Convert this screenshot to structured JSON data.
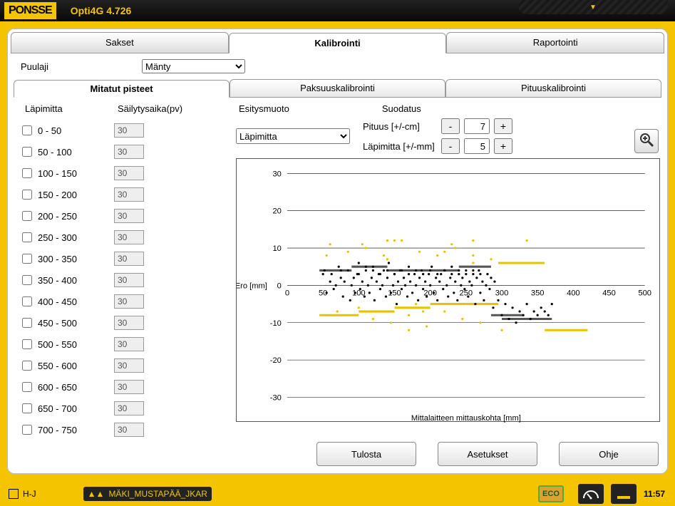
{
  "app": {
    "brand": "PONSSE",
    "title": "Opti4G 4.726"
  },
  "main_tabs": [
    {
      "label": "Sakset",
      "active": false
    },
    {
      "label": "Kalibrointi",
      "active": true
    },
    {
      "label": "Raportointi",
      "active": false
    }
  ],
  "species": {
    "label": "Puulaji",
    "selected": "Mänty",
    "options": [
      "Mänty"
    ]
  },
  "sub_tabs": [
    {
      "label": "Mitatut pisteet",
      "active": true
    },
    {
      "label": "Paksuuskalibrointi",
      "active": false
    },
    {
      "label": "Pituuskalibrointi",
      "active": false
    }
  ],
  "left": {
    "headers": {
      "diameter": "Läpimitta",
      "retention": "Säilytysaika(pv)"
    },
    "rows": [
      {
        "range": "0   - 50",
        "days": "30"
      },
      {
        "range": "50  - 100",
        "days": "30"
      },
      {
        "range": "100 - 150",
        "days": "30"
      },
      {
        "range": "150 - 200",
        "days": "30"
      },
      {
        "range": "200 - 250",
        "days": "30"
      },
      {
        "range": "250 - 300",
        "days": "30"
      },
      {
        "range": "300 - 350",
        "days": "30"
      },
      {
        "range": "350 - 400",
        "days": "30"
      },
      {
        "range": "400 - 450",
        "days": "30"
      },
      {
        "range": "450 - 500",
        "days": "30"
      },
      {
        "range": "500 - 550",
        "days": "30"
      },
      {
        "range": "550 - 600",
        "days": "30"
      },
      {
        "range": "600 - 650",
        "days": "30"
      },
      {
        "range": "650 - 700",
        "days": "30"
      },
      {
        "range": "700 - 750",
        "days": "30"
      }
    ]
  },
  "right": {
    "presentation_label": "Esitysmuoto",
    "presentation_value": "Läpimitta",
    "presentation_options": [
      "Läpimitta"
    ],
    "filter_label": "Suodatus",
    "length_label": "Pituus [+/-cm]",
    "length_value": "7",
    "diameter_label": "Läpimitta [+/-mm]",
    "diameter_value": "5",
    "minus": "-",
    "plus": "+",
    "zoom_icon": "⊕"
  },
  "chart_data": {
    "type": "scatter",
    "title": "",
    "xlabel": "Mittalaitteen mittauskohta [mm]",
    "ylabel": "Ero [mm]",
    "xlim": [
      0,
      500
    ],
    "ylim": [
      -30,
      30
    ],
    "xticks": [
      0,
      50,
      100,
      150,
      200,
      250,
      300,
      350,
      400,
      450,
      500
    ],
    "yticks": [
      -30,
      -20,
      -10,
      0,
      10,
      20,
      30
    ],
    "series": [
      {
        "name": "black",
        "color": "#000000",
        "points": [
          [
            52,
            4
          ],
          [
            55,
            -2
          ],
          [
            60,
            1
          ],
          [
            62,
            3
          ],
          [
            65,
            -1
          ],
          [
            68,
            0
          ],
          [
            72,
            5
          ],
          [
            75,
            2
          ],
          [
            78,
            -3
          ],
          [
            80,
            1
          ],
          [
            85,
            4
          ],
          [
            88,
            -4
          ],
          [
            90,
            0
          ],
          [
            93,
            2
          ],
          [
            95,
            -2
          ],
          [
            98,
            3
          ],
          [
            100,
            6
          ],
          [
            102,
            -1
          ],
          [
            105,
            1
          ],
          [
            108,
            -3
          ],
          [
            110,
            4
          ],
          [
            113,
            0
          ],
          [
            115,
            -2
          ],
          [
            118,
            2
          ],
          [
            120,
            5
          ],
          [
            122,
            -4
          ],
          [
            125,
            1
          ],
          [
            128,
            3
          ],
          [
            130,
            -1
          ],
          [
            133,
            0
          ],
          [
            135,
            4
          ],
          [
            138,
            -3
          ],
          [
            140,
            2
          ],
          [
            142,
            6
          ],
          [
            145,
            -2
          ],
          [
            148,
            0
          ],
          [
            150,
            3
          ],
          [
            153,
            -5
          ],
          [
            155,
            1
          ],
          [
            158,
            4
          ],
          [
            160,
            -1
          ],
          [
            163,
            2
          ],
          [
            165,
            0
          ],
          [
            168,
            -3
          ],
          [
            170,
            5
          ],
          [
            172,
            1
          ],
          [
            175,
            -2
          ],
          [
            178,
            3
          ],
          [
            180,
            0
          ],
          [
            183,
            -4
          ],
          [
            185,
            2
          ],
          [
            188,
            4
          ],
          [
            190,
            -1
          ],
          [
            193,
            1
          ],
          [
            195,
            -3
          ],
          [
            198,
            3
          ],
          [
            200,
            0
          ],
          [
            202,
            5
          ],
          [
            205,
            -2
          ],
          [
            208,
            2
          ],
          [
            210,
            -4
          ],
          [
            213,
            1
          ],
          [
            215,
            3
          ],
          [
            218,
            -1
          ],
          [
            220,
            4
          ],
          [
            223,
            0
          ],
          [
            225,
            -3
          ],
          [
            228,
            2
          ],
          [
            230,
            5
          ],
          [
            233,
            -2
          ],
          [
            235,
            1
          ],
          [
            238,
            -4
          ],
          [
            240,
            3
          ],
          [
            243,
            0
          ],
          [
            245,
            2
          ],
          [
            248,
            -1
          ],
          [
            250,
            4
          ],
          [
            253,
            -3
          ],
          [
            255,
            1
          ],
          [
            258,
            0
          ],
          [
            260,
            3
          ],
          [
            263,
            -5
          ],
          [
            265,
            2
          ],
          [
            268,
            4
          ],
          [
            270,
            -2
          ],
          [
            273,
            1
          ],
          [
            275,
            -4
          ],
          [
            278,
            0
          ],
          [
            280,
            3
          ],
          [
            283,
            -1
          ],
          [
            285,
            2
          ],
          [
            288,
            -6
          ],
          [
            290,
            1
          ],
          [
            295,
            -4
          ],
          [
            300,
            -8
          ],
          [
            305,
            -5
          ],
          [
            310,
            -9
          ],
          [
            315,
            -6
          ],
          [
            320,
            -10
          ],
          [
            325,
            -7
          ],
          [
            330,
            -8
          ],
          [
            335,
            -5
          ],
          [
            340,
            -9
          ],
          [
            345,
            -7
          ],
          [
            350,
            -8
          ],
          [
            355,
            -6
          ],
          [
            360,
            -7
          ],
          [
            365,
            -8
          ],
          [
            370,
            -5
          ],
          [
            50,
            3
          ],
          [
            75,
            4
          ],
          [
            100,
            3
          ],
          [
            110,
            5
          ],
          [
            120,
            4
          ],
          [
            130,
            3
          ],
          [
            140,
            4
          ],
          [
            150,
            3
          ],
          [
            160,
            4
          ],
          [
            170,
            3
          ],
          [
            180,
            4
          ],
          [
            190,
            3
          ],
          [
            200,
            4
          ],
          [
            210,
            3
          ],
          [
            220,
            4
          ],
          [
            230,
            3
          ],
          [
            240,
            4
          ],
          [
            250,
            3
          ],
          [
            260,
            4
          ],
          [
            270,
            3
          ]
        ]
      },
      {
        "name": "yellow",
        "color": "#e8c300",
        "points": [
          [
            55,
            8
          ],
          [
            70,
            -7
          ],
          [
            85,
            9
          ],
          [
            95,
            -8
          ],
          [
            110,
            10
          ],
          [
            120,
            -9
          ],
          [
            135,
            8
          ],
          [
            145,
            -10
          ],
          [
            160,
            12
          ],
          [
            170,
            -8
          ],
          [
            185,
            9
          ],
          [
            195,
            -11
          ],
          [
            210,
            8
          ],
          [
            220,
            -7
          ],
          [
            235,
            10
          ],
          [
            245,
            -9
          ],
          [
            260,
            8
          ],
          [
            270,
            -10
          ],
          [
            285,
            7
          ],
          [
            300,
            -12
          ],
          [
            60,
            11
          ],
          [
            100,
            -6
          ],
          [
            140,
            7
          ],
          [
            180,
            -5
          ],
          [
            220,
            9
          ],
          [
            260,
            6
          ],
          [
            150,
            12
          ],
          [
            190,
            -7
          ],
          [
            230,
            11
          ],
          [
            170,
            -12
          ],
          [
            335,
            12
          ],
          [
            260,
            12
          ],
          [
            140,
            12
          ],
          [
            105,
            11
          ]
        ]
      }
    ],
    "bars": [
      {
        "color": "#555",
        "segments": [
          [
            45,
            90,
            4
          ],
          [
            90,
            140,
            5
          ],
          [
            140,
            190,
            4
          ],
          [
            190,
            240,
            4
          ],
          [
            240,
            285,
            5
          ],
          [
            285,
            330,
            -8
          ],
          [
            300,
            370,
            -9
          ]
        ]
      },
      {
        "color": "#e8c300",
        "segments": [
          [
            45,
            100,
            -8
          ],
          [
            100,
            150,
            -7
          ],
          [
            150,
            200,
            -6
          ],
          [
            200,
            250,
            -5
          ],
          [
            250,
            295,
            -5
          ],
          [
            295,
            360,
            6
          ],
          [
            360,
            420,
            -12
          ]
        ]
      }
    ]
  },
  "buttons": {
    "print": "Tulosta",
    "settings": "Asetukset",
    "help": "Ohje"
  },
  "status": {
    "user": "H-J",
    "site": "MÄKI_MUSTAPÄÄ_JKAR",
    "eco": "ECO",
    "time": "11:57"
  }
}
